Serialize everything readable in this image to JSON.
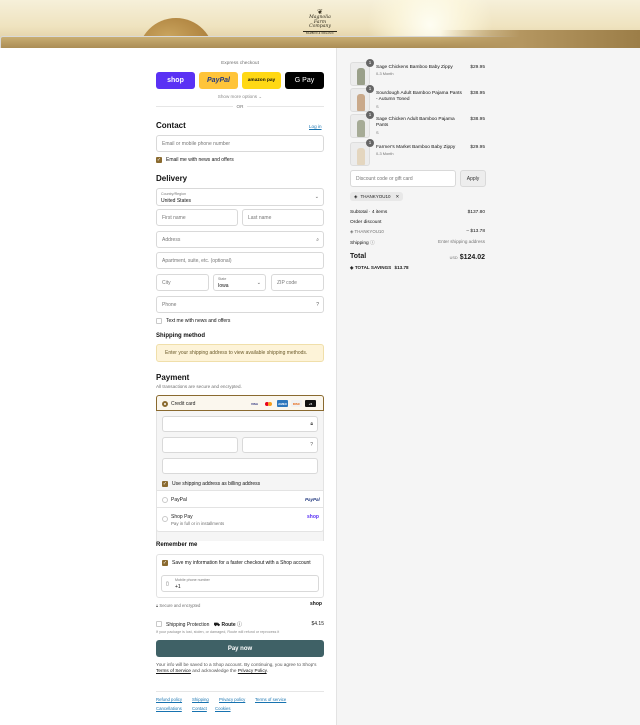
{
  "brand": {
    "line1": "Magnolia",
    "line2": "Farm Company",
    "tagline": "BAMBOO & ORGANIC"
  },
  "express": {
    "label": "Express checkout",
    "wallets": {
      "shop": "shop",
      "paypal": "PayPal",
      "amazon": "amazon pay",
      "gpay": "G Pay"
    },
    "more": "Show more options ⌄",
    "or": "OR"
  },
  "contact": {
    "title": "Contact",
    "login": "Log in",
    "email_placeholder": "Email or mobile phone number",
    "news_label": "Email me with news and offers"
  },
  "delivery": {
    "title": "Delivery",
    "country_label": "Country/Region",
    "country_value": "United States",
    "first_name": "First name",
    "last_name": "Last name",
    "address": "Address",
    "apartment": "Apartment, suite, etc. (optional)",
    "city": "City",
    "state_label": "State",
    "state_value": "Iowa",
    "zip": "ZIP code",
    "phone": "Phone",
    "text_label": "Text me with news and offers"
  },
  "shipping": {
    "title": "Shipping method",
    "notice": "Enter your shipping address to view available shipping methods."
  },
  "payment": {
    "title": "Payment",
    "subtitle": "All transactions are secure and encrypted.",
    "credit_card": "Credit card",
    "badges": [
      "VISA",
      "MC",
      "AMEX",
      "DISC",
      "+5"
    ],
    "billing_label": "Use shipping address as billing address",
    "paypal": "PayPal",
    "paypal_logo": "PayPal",
    "shop_pay": "Shop Pay",
    "shop_pay_sub": "Pay in full or in installments",
    "shop_logo": "shop"
  },
  "remember": {
    "title": "Remember me",
    "save_label": "Save my information for a faster checkout with a Shop account",
    "mobile_label": "Mobile phone number",
    "mobile_value": "+1",
    "secure": "Secure and encrypted",
    "shop_logo": "shop"
  },
  "protection": {
    "label": "Shipping Protection",
    "brand": "Route",
    "price": "$4.15",
    "sub": "If your package is lost, stolen, or damaged, Route will refund or reprocess it"
  },
  "pay_button": "Pay now",
  "legal": {
    "pre": "Your info will be saved to a Shop account. By continuing, you agree to Shop's ",
    "tos": "Terms of Service",
    "mid": " and acknowledge the ",
    "privacy": "Privacy Policy",
    "post": "."
  },
  "footer_links": [
    "Refund policy",
    "Shipping",
    "Privacy policy",
    "Terms of service",
    "Cancellations",
    "Contact",
    "Cookies"
  ],
  "cart": {
    "items": [
      {
        "qty": "1",
        "name": "Sage Chickens Bamboo Baby Zippy",
        "variant": "0-3 Month",
        "price": "$29.95",
        "color": "#9aa08a"
      },
      {
        "qty": "1",
        "name": "Sourdough Adult Bamboo Pajama Pants - Autumn Toned",
        "variant": "S",
        "price": "$38.95",
        "color": "#c9a98a"
      },
      {
        "qty": "1",
        "name": "Sage Chicken Adult Bamboo Pajama Pants",
        "variant": "S",
        "price": "$38.95",
        "color": "#a6ab96"
      },
      {
        "qty": "1",
        "name": "Farmer's Market Bamboo Baby Zippy",
        "variant": "0-3 Month",
        "price": "$29.95",
        "color": "#e4d6bf"
      }
    ],
    "discount_placeholder": "Discount code or gift card",
    "apply": "Apply",
    "code": "THANKYOU10",
    "subtotal_label": "Subtotal · 4 items",
    "subtotal": "$137.80",
    "order_discount": "Order discount",
    "discount_code": "THANKYOU10",
    "discount_amount": "– $13.78",
    "shipping_label": "Shipping",
    "shipping_value": "Enter shipping address",
    "total_label": "Total",
    "currency": "USD",
    "total": "$124.02",
    "savings_label": "TOTAL SAVINGS",
    "savings": "$13.78"
  }
}
